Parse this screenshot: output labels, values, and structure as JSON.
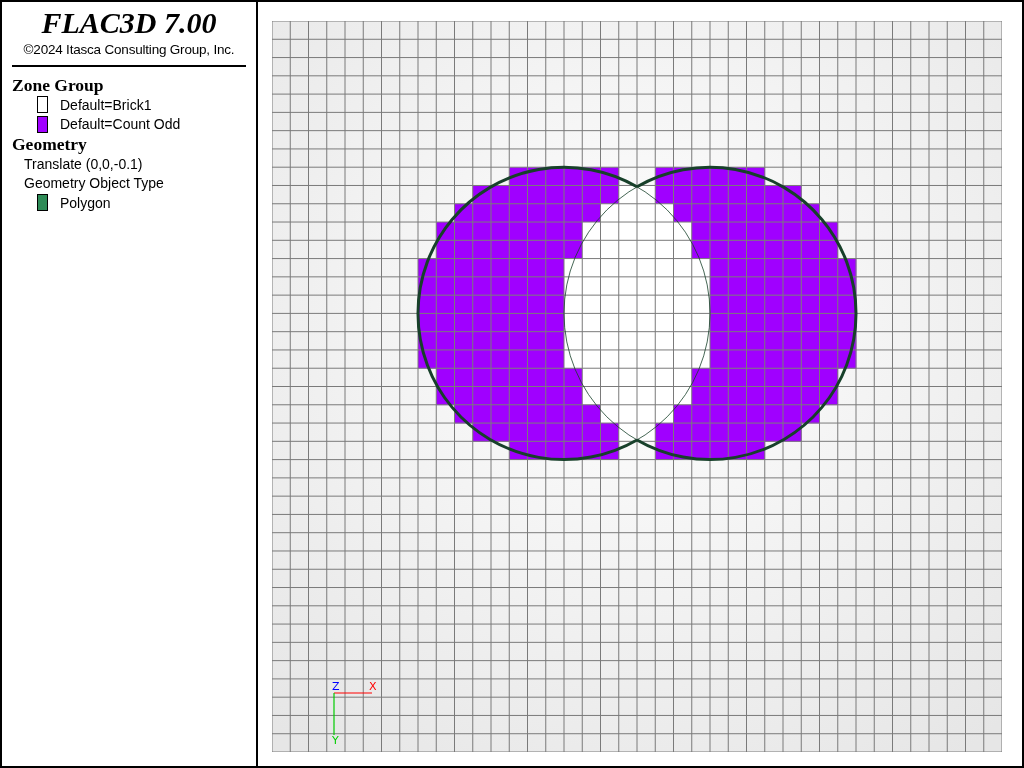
{
  "title": "FLAC3D 7.00",
  "copyright": "©2024 Itasca Consulting Group, Inc.",
  "legend": [
    {
      "heading": "Zone Group",
      "items": [
        {
          "kind": "swatch",
          "label": "Default=Brick1",
          "color": "#ffffff"
        },
        {
          "kind": "swatch",
          "label": "Default=Count Odd",
          "color": "#a000ff"
        }
      ]
    },
    {
      "heading": "Geometry",
      "items": [
        {
          "kind": "text",
          "label": "Translate (0,0,-0.1)"
        },
        {
          "kind": "text",
          "label": "Geometry Object Type"
        },
        {
          "kind": "swatch",
          "label": "Polygon",
          "color": "#2e8b57"
        }
      ]
    }
  ],
  "axes": {
    "z_label": "Z",
    "x_label": "X",
    "y_label": "Y"
  }
}
